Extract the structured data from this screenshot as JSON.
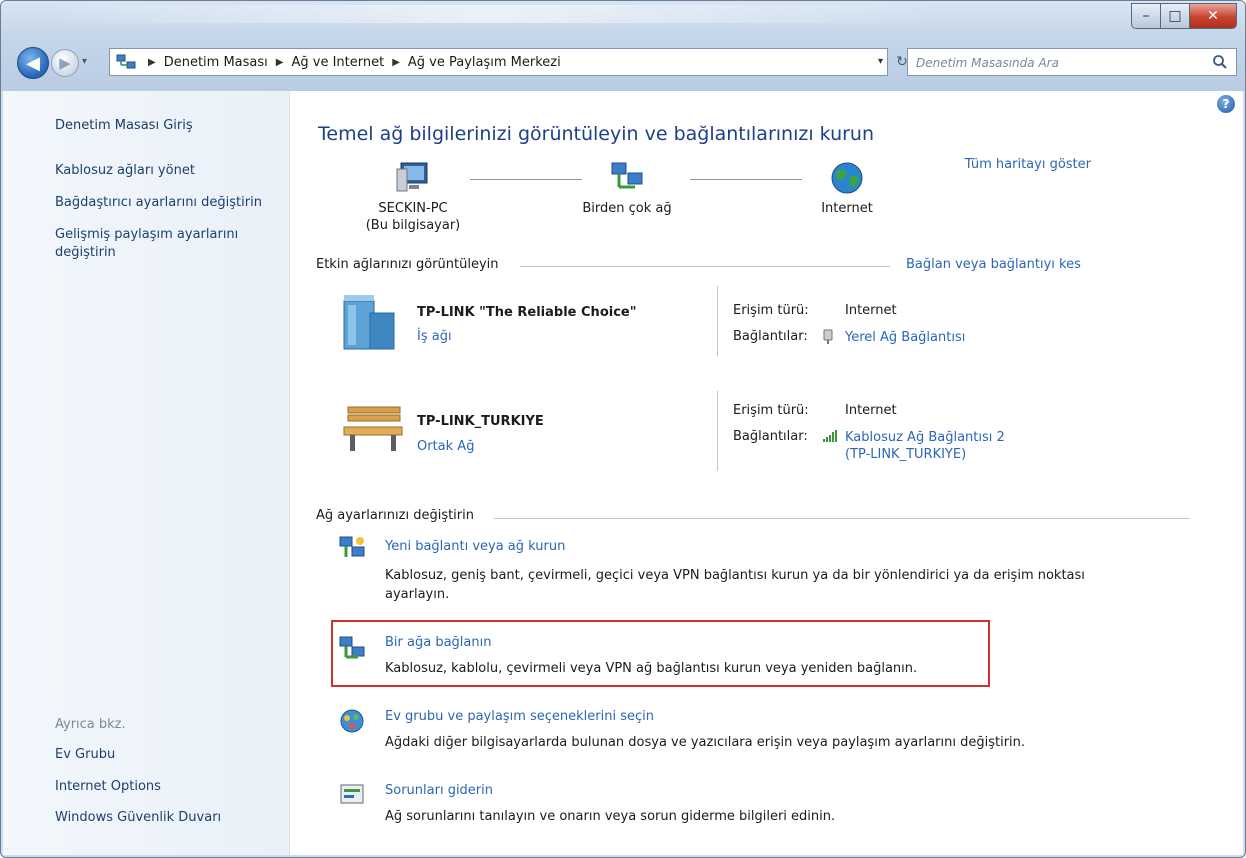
{
  "window": {
    "controls": {
      "minimize": "–",
      "maximize": "□",
      "close": "✕"
    }
  },
  "nav": {
    "back_glyph": "◀",
    "forward_glyph": "▶",
    "dropdown_glyph": "▾",
    "breadcrumb": [
      "Denetim Masası",
      "Ağ ve Internet",
      "Ağ ve Paylaşım Merkezi"
    ],
    "breadcrumb_sep": "▶",
    "refresh_glyph": "↻",
    "search_placeholder": "Denetim Masasında Ara"
  },
  "sidebar": {
    "home": "Denetim Masası Giriş",
    "links": [
      "Kablosuz ağları yönet",
      "Bağdaştırıcı ayarlarını değiştirin",
      "Gelişmiş paylaşım ayarlarını değiştirin"
    ],
    "see_also_label": "Ayrıca bkz.",
    "see_also": [
      "Ev Grubu",
      "Internet Options",
      "Windows Güvenlik Duvarı"
    ]
  },
  "main": {
    "help": "?",
    "title": "Temel ağ bilgilerinizi görüntüleyin ve bağlantılarınızı kurun",
    "map_link": "Tüm haritayı göster",
    "map_nodes": [
      {
        "label": "SECKIN-PC",
        "sublabel": "(Bu bilgisayar)",
        "icon": "computer-icon"
      },
      {
        "label": "Birden çok ağ",
        "sublabel": "",
        "icon": "network-icon"
      },
      {
        "label": "Internet",
        "sublabel": "",
        "icon": "globe-icon"
      }
    ],
    "active_section": {
      "header": "Etkin ağlarınızı görüntüleyin",
      "link": "Bağlan veya bağlantıyı kes"
    },
    "networks": [
      {
        "name": "TP-LINK \"The Reliable Choice\"",
        "type": "İş ağı",
        "icon": "work-network-icon",
        "access_label": "Erişim türü:",
        "access_value": "Internet",
        "connections_label": "Bağlantılar:",
        "connection_icon": "ethernet-icon",
        "connection": "Yerel Ağ Bağlantısı"
      },
      {
        "name": "TP-LINK_TURKIYE",
        "type": "Ortak Ağ",
        "icon": "public-network-bench-icon",
        "access_label": "Erişim türü:",
        "access_value": "Internet",
        "connections_label": "Bağlantılar:",
        "connection_icon": "wireless-signal-icon",
        "connection": "Kablosuz Ağ Bağlantısı 2",
        "connection_sub": "(TP-LINK_TURKIYE)"
      }
    ],
    "change_section": {
      "header": "Ağ ayarlarınızı değiştirin"
    },
    "tasks": [
      {
        "title": "Yeni bağlantı veya ağ kurun",
        "desc": "Kablosuz, geniş bant, çevirmeli, geçici veya VPN bağlantısı kurun ya da bir yönlendirici ya da erişim noktası ayarlayın.",
        "icon": "new-connection-icon"
      },
      {
        "title": "Bir ağa bağlanın",
        "desc": "Kablosuz, kablolu, çevirmeli veya VPN ağ bağlantısı kurun veya yeniden bağlanın.",
        "icon": "connect-network-icon"
      },
      {
        "title": "Ev grubu ve paylaşım seçeneklerini seçin",
        "desc": "Ağdaki diğer bilgisayarlarda bulunan dosya ve yazıcılara erişin veya paylaşım ayarlarını değiştirin.",
        "icon": "homegroup-icon"
      },
      {
        "title": "Sorunları giderin",
        "desc": "Ağ sorunlarını tanılayın ve onarın veya sorun giderme bilgileri edinin.",
        "icon": "troubleshoot-icon"
      }
    ]
  }
}
